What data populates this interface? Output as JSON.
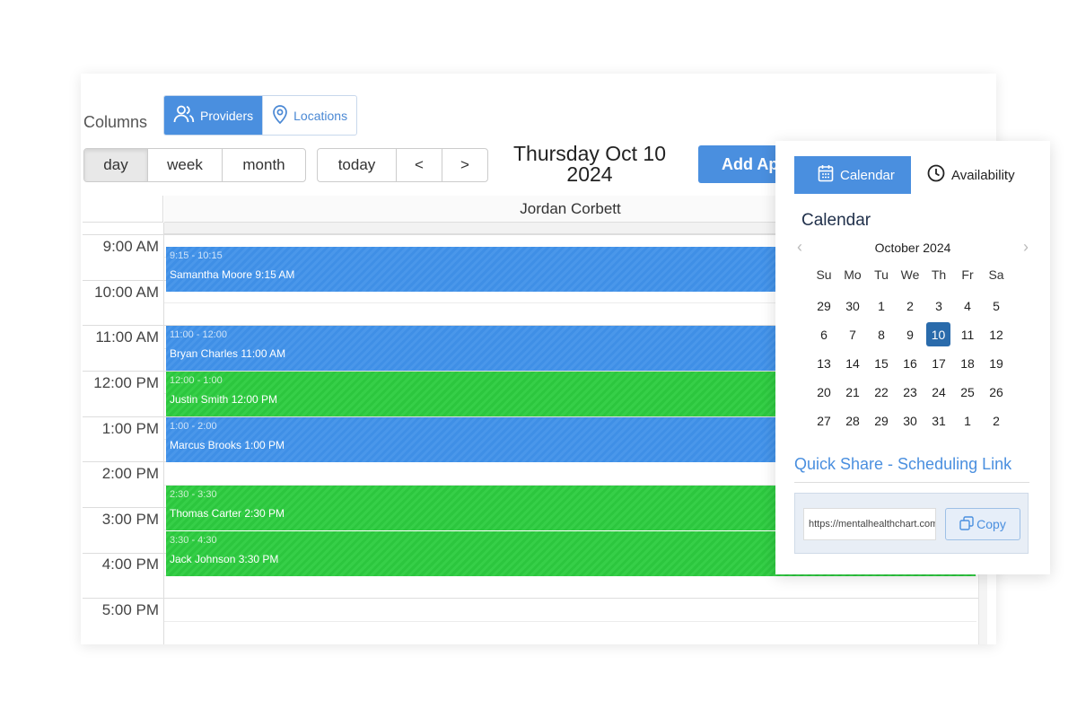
{
  "columns": {
    "label": "Columns",
    "options": [
      {
        "label": "Providers",
        "icon": "users-icon",
        "active": true
      },
      {
        "label": "Locations",
        "icon": "location-pin-icon",
        "active": false
      }
    ]
  },
  "view_buttons": [
    {
      "label": "day",
      "active": true
    },
    {
      "label": "week",
      "active": false
    },
    {
      "label": "month",
      "active": false
    }
  ],
  "nav_buttons": {
    "today": "today",
    "prev": "<",
    "next": ">"
  },
  "date_title": {
    "line1": "Thursday Oct 10",
    "line2": "2024"
  },
  "add_button": "Add Appointment",
  "provider": "Jordan Corbett",
  "time_labels": [
    "9:00 AM",
    "10:00 AM",
    "11:00 AM",
    "12:00 PM",
    "1:00 PM",
    "2:00 PM",
    "3:00 PM",
    "4:00 PM",
    "5:00 PM"
  ],
  "events": [
    {
      "time": "9:15 - 10:15",
      "title": "Samantha Moore 9:15 AM",
      "color": "blue"
    },
    {
      "time": "11:00 - 12:00",
      "title": "Bryan Charles 11:00 AM",
      "color": "blue"
    },
    {
      "time": "12:00 - 1:00",
      "title": "Justin Smith 12:00 PM",
      "color": "green"
    },
    {
      "time": "1:00 - 2:00",
      "title": "Marcus Brooks 1:00 PM",
      "color": "blue"
    },
    {
      "time": "2:30 - 3:30",
      "title": "Thomas Carter 2:30 PM",
      "color": "green"
    },
    {
      "time": "3:30 - 4:30",
      "title": "Jack Johnson 3:30 PM",
      "color": "green"
    }
  ],
  "panel": {
    "tabs": [
      {
        "label": "Calendar",
        "icon": "calendar-icon",
        "active": true
      },
      {
        "label": "Availability",
        "icon": "clock-icon",
        "active": false
      }
    ],
    "heading": "Calendar",
    "mini_calendar": {
      "month_label": "October 2024",
      "prev": "‹",
      "next": "›",
      "weekdays": [
        "Su",
        "Mo",
        "Tu",
        "We",
        "Th",
        "Fr",
        "Sa"
      ],
      "days": [
        "29",
        "30",
        "1",
        "2",
        "3",
        "4",
        "5",
        "6",
        "7",
        "8",
        "9",
        "10",
        "11",
        "12",
        "13",
        "14",
        "15",
        "16",
        "17",
        "18",
        "19",
        "20",
        "21",
        "22",
        "23",
        "24",
        "25",
        "26",
        "27",
        "28",
        "29",
        "30",
        "31",
        "1",
        "2"
      ],
      "selected": "10"
    },
    "quick_share_title": "Quick Share - Scheduling Link",
    "link_value": "https://mentalhealthchart.com",
    "copy_label": "Copy"
  },
  "colors": {
    "accent": "#4a8fdf",
    "event_blue": "#3f8fe6",
    "event_green": "#2cc63e",
    "selected_day": "#2a6bab"
  }
}
